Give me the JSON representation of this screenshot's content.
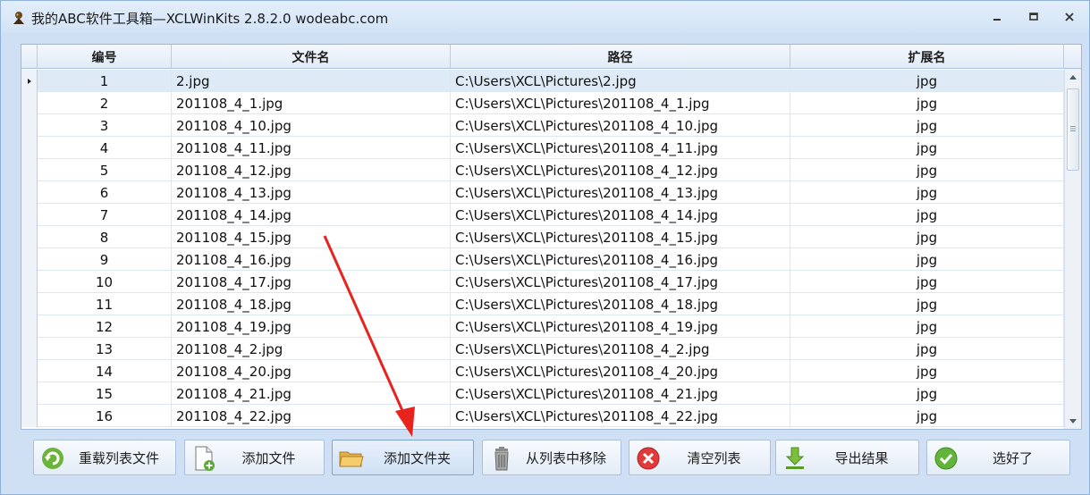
{
  "window": {
    "title": "我的ABC软件工具箱—XCLWinKits 2.8.2.0  wodeabc.com"
  },
  "grid": {
    "columns": [
      "编号",
      "文件名",
      "路径",
      "扩展名"
    ],
    "rows": [
      {
        "num": "1",
        "name": "2.jpg",
        "path": "C:\\Users\\XCL\\Pictures\\2.jpg",
        "ext": "jpg"
      },
      {
        "num": "2",
        "name": "201108_4_1.jpg",
        "path": "C:\\Users\\XCL\\Pictures\\201108_4_1.jpg",
        "ext": "jpg"
      },
      {
        "num": "3",
        "name": "201108_4_10.jpg",
        "path": "C:\\Users\\XCL\\Pictures\\201108_4_10.jpg",
        "ext": "jpg"
      },
      {
        "num": "4",
        "name": "201108_4_11.jpg",
        "path": "C:\\Users\\XCL\\Pictures\\201108_4_11.jpg",
        "ext": "jpg"
      },
      {
        "num": "5",
        "name": "201108_4_12.jpg",
        "path": "C:\\Users\\XCL\\Pictures\\201108_4_12.jpg",
        "ext": "jpg"
      },
      {
        "num": "6",
        "name": "201108_4_13.jpg",
        "path": "C:\\Users\\XCL\\Pictures\\201108_4_13.jpg",
        "ext": "jpg"
      },
      {
        "num": "7",
        "name": "201108_4_14.jpg",
        "path": "C:\\Users\\XCL\\Pictures\\201108_4_14.jpg",
        "ext": "jpg"
      },
      {
        "num": "8",
        "name": "201108_4_15.jpg",
        "path": "C:\\Users\\XCL\\Pictures\\201108_4_15.jpg",
        "ext": "jpg"
      },
      {
        "num": "9",
        "name": "201108_4_16.jpg",
        "path": "C:\\Users\\XCL\\Pictures\\201108_4_16.jpg",
        "ext": "jpg"
      },
      {
        "num": "10",
        "name": "201108_4_17.jpg",
        "path": "C:\\Users\\XCL\\Pictures\\201108_4_17.jpg",
        "ext": "jpg"
      },
      {
        "num": "11",
        "name": "201108_4_18.jpg",
        "path": "C:\\Users\\XCL\\Pictures\\201108_4_18.jpg",
        "ext": "jpg"
      },
      {
        "num": "12",
        "name": "201108_4_19.jpg",
        "path": "C:\\Users\\XCL\\Pictures\\201108_4_19.jpg",
        "ext": "jpg"
      },
      {
        "num": "13",
        "name": "201108_4_2.jpg",
        "path": "C:\\Users\\XCL\\Pictures\\201108_4_2.jpg",
        "ext": "jpg"
      },
      {
        "num": "14",
        "name": "201108_4_20.jpg",
        "path": "C:\\Users\\XCL\\Pictures\\201108_4_20.jpg",
        "ext": "jpg"
      },
      {
        "num": "15",
        "name": "201108_4_21.jpg",
        "path": "C:\\Users\\XCL\\Pictures\\201108_4_21.jpg",
        "ext": "jpg"
      },
      {
        "num": "16",
        "name": "201108_4_22.jpg",
        "path": "C:\\Users\\XCL\\Pictures\\201108_4_22.jpg",
        "ext": "jpg"
      }
    ]
  },
  "toolbar": {
    "reload": "重载列表文件",
    "add_file": "添加文件",
    "add_folder": "添加文件夹",
    "remove": "从列表中移除",
    "clear": "清空列表",
    "export": "导出结果",
    "done": "选好了"
  },
  "icons": {
    "app": "app-icon",
    "reload": "refresh-icon",
    "add_file": "add-file-icon",
    "add_folder": "folder-icon",
    "remove": "trash-icon",
    "clear": "clear-icon",
    "export": "download-icon",
    "done": "checkmark-icon"
  },
  "colors": {
    "accent": "#3a6fb6",
    "arrow": "#e8231e",
    "selected_row": "#dfeaf7"
  }
}
